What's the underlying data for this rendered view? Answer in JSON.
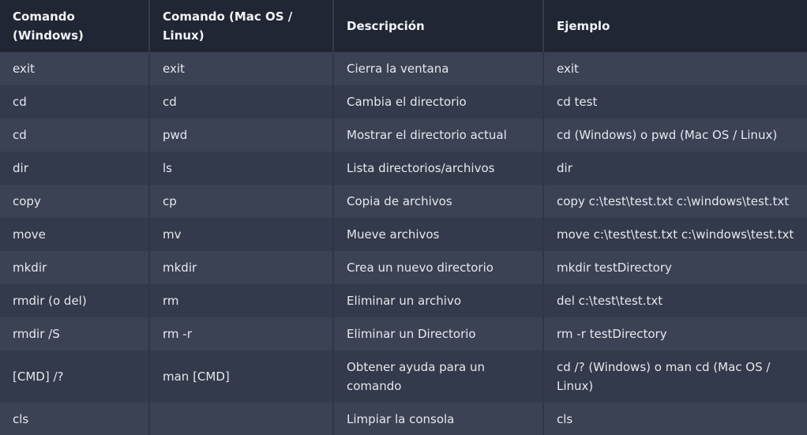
{
  "headers": [
    "Comando (Windows)",
    "Comando (Mac OS / Linux)",
    "Descripción",
    "Ejemplo"
  ],
  "rows": [
    [
      "exit",
      "exit",
      "Cierra la ventana",
      "exit"
    ],
    [
      "cd",
      "cd",
      "Cambia el directorio",
      "cd test"
    ],
    [
      "cd",
      "pwd",
      "Mostrar el directorio actual",
      "cd (Windows) o pwd (Mac OS / Linux)"
    ],
    [
      "dir",
      "ls",
      "Lista directorios/archivos",
      "dir"
    ],
    [
      "copy",
      "cp",
      "Copia de archivos",
      "copy c:\\test\\test.txt c:\\windows\\test.txt"
    ],
    [
      "move",
      "mv",
      "Mueve archivos",
      "move c:\\test\\test.txt c:\\windows\\test.txt"
    ],
    [
      "mkdir",
      "mkdir",
      "Crea un nuevo directorio",
      "mkdir testDirectory"
    ],
    [
      "rmdir (o del)",
      "rm",
      "Eliminar un archivo",
      "del c:\\test\\test.txt"
    ],
    [
      "rmdir /S",
      "rm -r",
      "Eliminar un Directorio",
      "rm -r testDirectory"
    ],
    [
      "[CMD] /?",
      "man [CMD]",
      "Obtener ayuda para un comando",
      "cd /? (Windows) o man cd (Mac OS / Linux)"
    ],
    [
      "cls",
      "",
      "Limpiar la consola",
      "cls"
    ]
  ]
}
